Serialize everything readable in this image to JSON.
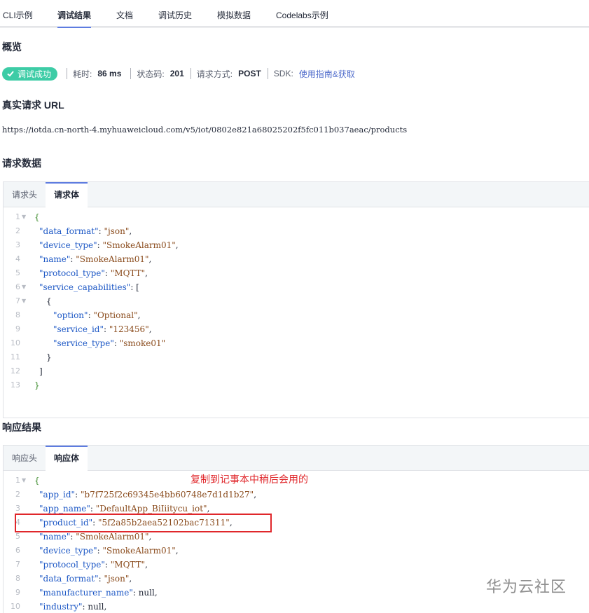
{
  "tabs": [
    {
      "label": "CLI示例"
    },
    {
      "label": "调试结果"
    },
    {
      "label": "文档"
    },
    {
      "label": "调试历史"
    },
    {
      "label": "模拟数据"
    },
    {
      "label": "Codelabs示例"
    }
  ],
  "overview": {
    "title": "概览",
    "status_badge": "调试成功",
    "time_label": "耗时:",
    "time_value": "86 ms",
    "code_label": "状态码:",
    "code_value": "201",
    "method_label": "请求方式:",
    "method_value": "POST",
    "sdk_label": "SDK:",
    "sdk_link": "使用指南&获取"
  },
  "url_section": {
    "title": "真实请求 URL",
    "url": "https://iotda.cn-north-4.myhuaweicloud.com/v5/iot/0802e821a68025202f5fc011b037aeac/products"
  },
  "request": {
    "title": "请求数据",
    "tabs": [
      "请求头",
      "请求体"
    ],
    "lines": [
      {
        "n": "1",
        "fold": true,
        "indent": 0,
        "parts": [
          {
            "t": "{",
            "c": "br"
          }
        ]
      },
      {
        "n": "2",
        "indent": 1,
        "parts": [
          {
            "t": "\"data_format\"",
            "c": "k"
          },
          {
            "t": ": ",
            "c": ""
          },
          {
            "t": "\"json\"",
            "c": "s"
          },
          {
            "t": ",",
            "c": ""
          }
        ]
      },
      {
        "n": "3",
        "indent": 1,
        "parts": [
          {
            "t": "\"device_type\"",
            "c": "k"
          },
          {
            "t": ": ",
            "c": ""
          },
          {
            "t": "\"SmokeAlarm01\"",
            "c": "s"
          },
          {
            "t": ",",
            "c": ""
          }
        ]
      },
      {
        "n": "4",
        "indent": 1,
        "parts": [
          {
            "t": "\"name\"",
            "c": "k"
          },
          {
            "t": ": ",
            "c": ""
          },
          {
            "t": "\"SmokeAlarm01\"",
            "c": "s"
          },
          {
            "t": ",",
            "c": ""
          }
        ]
      },
      {
        "n": "5",
        "indent": 1,
        "parts": [
          {
            "t": "\"protocol_type\"",
            "c": "k"
          },
          {
            "t": ": ",
            "c": ""
          },
          {
            "t": "\"MQTT\"",
            "c": "s"
          },
          {
            "t": ",",
            "c": ""
          }
        ]
      },
      {
        "n": "6",
        "fold": true,
        "indent": 1,
        "parts": [
          {
            "t": "\"service_capabilities\"",
            "c": "k"
          },
          {
            "t": ": [",
            "c": ""
          }
        ]
      },
      {
        "n": "7",
        "fold": true,
        "indent": 2,
        "parts": [
          {
            "t": "{",
            "c": ""
          }
        ]
      },
      {
        "n": "8",
        "indent": 3,
        "parts": [
          {
            "t": "\"option\"",
            "c": "k"
          },
          {
            "t": ": ",
            "c": ""
          },
          {
            "t": "\"Optional\"",
            "c": "s"
          },
          {
            "t": ",",
            "c": ""
          }
        ]
      },
      {
        "n": "9",
        "indent": 3,
        "parts": [
          {
            "t": "\"service_id\"",
            "c": "k"
          },
          {
            "t": ": ",
            "c": ""
          },
          {
            "t": "\"123456\"",
            "c": "s"
          },
          {
            "t": ",",
            "c": ""
          }
        ]
      },
      {
        "n": "10",
        "indent": 3,
        "parts": [
          {
            "t": "\"service_type\"",
            "c": "k"
          },
          {
            "t": ": ",
            "c": ""
          },
          {
            "t": "\"smoke01\"",
            "c": "s"
          }
        ]
      },
      {
        "n": "11",
        "indent": 2,
        "parts": [
          {
            "t": "}",
            "c": ""
          }
        ]
      },
      {
        "n": "12",
        "indent": 1,
        "parts": [
          {
            "t": "]",
            "c": ""
          }
        ]
      },
      {
        "n": "13",
        "indent": 0,
        "parts": [
          {
            "t": "}",
            "c": "br"
          }
        ]
      }
    ]
  },
  "response": {
    "title": "响应结果",
    "tabs": [
      "响应头",
      "响应体"
    ],
    "annotation": "复制到记事本中稍后会用的",
    "lines": [
      {
        "n": "1",
        "fold": true,
        "indent": 0,
        "parts": [
          {
            "t": "{",
            "c": "br"
          }
        ]
      },
      {
        "n": "2",
        "indent": 1,
        "parts": [
          {
            "t": "\"app_id\"",
            "c": "k"
          },
          {
            "t": ": ",
            "c": ""
          },
          {
            "t": "\"b7f725f2c69345e4bb60748e7d1d1b27\"",
            "c": "s"
          },
          {
            "t": ",",
            "c": ""
          }
        ]
      },
      {
        "n": "3",
        "indent": 1,
        "parts": [
          {
            "t": "\"app_name\"",
            "c": "k"
          },
          {
            "t": ": ",
            "c": ""
          },
          {
            "t": "\"DefaultApp_BiIiitycu_iot\"",
            "c": "s"
          },
          {
            "t": ",",
            "c": ""
          }
        ]
      },
      {
        "n": "4",
        "indent": 1,
        "parts": [
          {
            "t": "\"product_id\"",
            "c": "k"
          },
          {
            "t": ": ",
            "c": ""
          },
          {
            "t": "\"5f2a85b2aea52102bac71311\"",
            "c": "s"
          },
          {
            "t": ",",
            "c": ""
          }
        ]
      },
      {
        "n": "5",
        "indent": 1,
        "parts": [
          {
            "t": "\"name\"",
            "c": "k"
          },
          {
            "t": ": ",
            "c": ""
          },
          {
            "t": "\"SmokeAlarm01\"",
            "c": "s"
          },
          {
            "t": ",",
            "c": ""
          }
        ]
      },
      {
        "n": "6",
        "indent": 1,
        "parts": [
          {
            "t": "\"device_type\"",
            "c": "k"
          },
          {
            "t": ": ",
            "c": ""
          },
          {
            "t": "\"SmokeAlarm01\"",
            "c": "s"
          },
          {
            "t": ",",
            "c": ""
          }
        ]
      },
      {
        "n": "7",
        "indent": 1,
        "parts": [
          {
            "t": "\"protocol_type\"",
            "c": "k"
          },
          {
            "t": ": ",
            "c": ""
          },
          {
            "t": "\"MQTT\"",
            "c": "s"
          },
          {
            "t": ",",
            "c": ""
          }
        ]
      },
      {
        "n": "8",
        "indent": 1,
        "parts": [
          {
            "t": "\"data_format\"",
            "c": "k"
          },
          {
            "t": ": ",
            "c": ""
          },
          {
            "t": "\"json\"",
            "c": "s"
          },
          {
            "t": ",",
            "c": ""
          }
        ]
      },
      {
        "n": "9",
        "indent": 1,
        "parts": [
          {
            "t": "\"manufacturer_name\"",
            "c": "k"
          },
          {
            "t": ": null,",
            "c": ""
          }
        ]
      },
      {
        "n": "10",
        "indent": 1,
        "parts": [
          {
            "t": "\"industry\"",
            "c": "k"
          },
          {
            "t": ": null,",
            "c": ""
          }
        ]
      }
    ]
  },
  "watermark": "华为云社区",
  "colors": {
    "accent": "#5e7ce0",
    "success": "#3dcca6",
    "annotation": "#e0272b",
    "key": "#1c57c5",
    "string": "#8a4b1c"
  }
}
